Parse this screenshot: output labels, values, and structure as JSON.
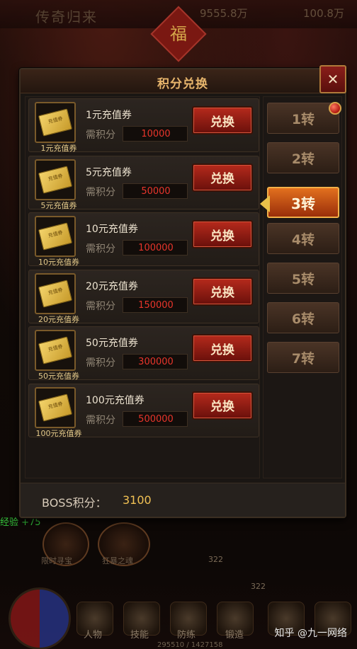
{
  "background": {
    "game_title": "传奇归来",
    "gold": "9555.8万",
    "ingot": "100.8万",
    "fu_char": "福",
    "exp_gain": "经验 +75",
    "hud_btn1_label": "限时寻宝",
    "hud_btn2_label": "狂暴之魂",
    "num_a": "322",
    "num_b": "322",
    "bar_labels": [
      "人物",
      "技能",
      "防练",
      "锻造"
    ],
    "xp_progress": "295510 / 1427158",
    "watermark": "知乎 @九一网络"
  },
  "panel": {
    "title": "积分兑换",
    "close_symbol": "✕",
    "cost_label": "需积分",
    "exchange_label": "兑换",
    "ticket_text": "充值券",
    "items": [
      {
        "name": "1元充值券",
        "caption": "1元充值券",
        "cost": "10000"
      },
      {
        "name": "5元充值券",
        "caption": "5元充值券",
        "cost": "50000"
      },
      {
        "name": "10元充值券",
        "caption": "10元充值券",
        "cost": "100000"
      },
      {
        "name": "20元充值券",
        "caption": "20元充值券",
        "cost": "150000"
      },
      {
        "name": "50元充值券",
        "caption": "50元充值券",
        "cost": "300000"
      },
      {
        "name": "100元充值券",
        "caption": "100元充值券",
        "cost": "500000"
      }
    ],
    "tabs": [
      "1转",
      "2转",
      "3转",
      "4转",
      "5转",
      "6转",
      "7转"
    ],
    "active_tab": "3转",
    "boss_label": "BOSS积分：",
    "boss_value": "3100"
  },
  "colors": {
    "accent": "#e7b56c",
    "cost_red": "#e8352b",
    "boss_gold": "#f1c154",
    "exp_green": "#34c33b"
  }
}
